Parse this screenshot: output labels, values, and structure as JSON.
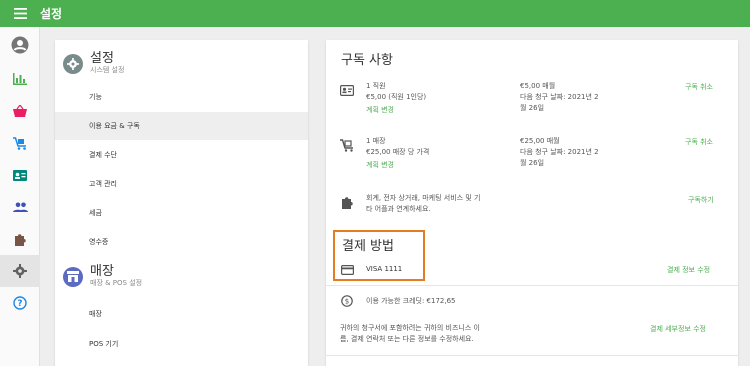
{
  "topbar": {
    "title": "설정",
    "menu_icon": "menu-icon"
  },
  "rail": {
    "items": [
      {
        "icon": "account-circle-icon",
        "color": "#616161"
      },
      {
        "icon": "bar-chart-icon",
        "color": "#4caf50"
      },
      {
        "icon": "basket-icon",
        "color": "#e91e63"
      },
      {
        "icon": "cart-icon",
        "color": "#1e88e5"
      },
      {
        "icon": "contact-card-icon",
        "color": "#00897b"
      },
      {
        "icon": "people-icon",
        "color": "#3f51b5"
      },
      {
        "icon": "puzzle-icon",
        "color": "#795548"
      },
      {
        "icon": "gear-icon",
        "color": "#616161"
      },
      {
        "icon": "help-icon",
        "color": "#1e88e5"
      }
    ],
    "active_index": 7
  },
  "left": {
    "system": {
      "title": "설정",
      "subtitle": "시스템 설정",
      "items": [
        "기능",
        "이용 요금 & 구독",
        "결제 수단",
        "고객 관리",
        "세금",
        "영수증"
      ],
      "active_index": 1
    },
    "store": {
      "title": "매장",
      "subtitle": "매장 & POS 설정",
      "items": [
        "매장",
        "POS 기기"
      ]
    }
  },
  "subscriptions": {
    "title": "구독 사항",
    "rows": [
      {
        "icon": "id-card-icon",
        "name": "1 직원",
        "detail": "€5,00 (직원 1인당)",
        "change": "계획 변경",
        "price": "€5,00 매월",
        "billing": "다음 청구 날짜: 2021년 2",
        "billing2": "월 26일",
        "action": "구독 취소"
      },
      {
        "icon": "cart-icon",
        "name": "1 매장",
        "detail": "€25,00 매장 당 가격",
        "change": "계획 변경",
        "price": "€25,00 매월",
        "billing": "다음 청구 날짜: 2021년 2",
        "billing2": "월 26일",
        "action": "구독 취소"
      }
    ],
    "addon": {
      "icon": "puzzle-icon",
      "text1": "회계, 전자 상거래, 마케팅 서비스 및 기",
      "text2": "타 어플과 연계하세요.",
      "action": "구독하기"
    }
  },
  "payment": {
    "title": "결제 방법",
    "card_icon": "credit-card-icon",
    "card": "VISA 1111",
    "edit_card": "결제 정보 수정",
    "credit_icon": "credit-coin-icon",
    "credit": "이용 가능한 크레딧: €172,65",
    "billing_text1": "귀하의 청구서에 포함하려는 귀하의 비즈니스 이",
    "billing_text2": "름, 결제 연락처 또는 다른 정보를 수정하세요.",
    "billing_edit": "결제 세부정보 수정"
  },
  "colors": {
    "primary": "#4caf50",
    "highlight": "#e37d20"
  }
}
